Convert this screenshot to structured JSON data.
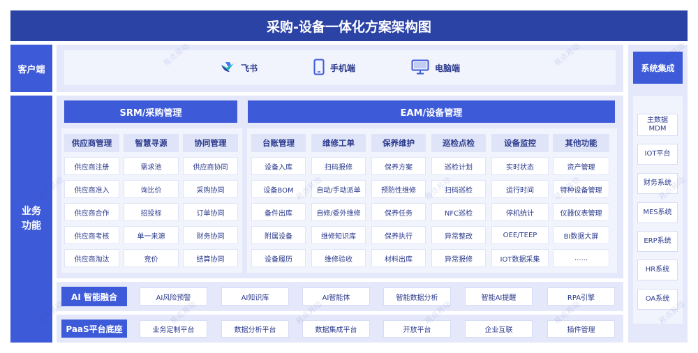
{
  "title": "采购-设备一体化方案架构图",
  "left_labels": {
    "client": "客户端",
    "business_line1": "业务",
    "business_line2": "功能"
  },
  "client_items": [
    {
      "icon": "feishu-icon",
      "label": "飞书"
    },
    {
      "icon": "mobile-phone-icon",
      "label": "手机端"
    },
    {
      "icon": "desktop-monitor-icon",
      "label": "电脑端"
    }
  ],
  "srm": {
    "title": "SRM/采购管理",
    "columns": [
      {
        "head": "供应商管理",
        "items": [
          "供应商注册",
          "供应商准入",
          "供应商合作",
          "供应商考核",
          "供应商淘汰"
        ]
      },
      {
        "head": "智慧寻源",
        "items": [
          "需求池",
          "询比价",
          "招投标",
          "单一来源",
          "竞价"
        ]
      },
      {
        "head": "协同管理",
        "items": [
          "供应商协同",
          "采购协同",
          "订单协同",
          "财务协同",
          "结算协同"
        ]
      }
    ]
  },
  "eam": {
    "title": "EAM/设备管理",
    "columns": [
      {
        "head": "台账管理",
        "items": [
          "设备入库",
          "设备BOM",
          "备件出库",
          "附属设备",
          "设备履历"
        ]
      },
      {
        "head": "维修工单",
        "items": [
          "扫码报修",
          "自动/手动派单",
          "自修/委外维修",
          "维修知识库",
          "维修验收"
        ]
      },
      {
        "head": "保养维护",
        "items": [
          "保养方案",
          "预防性维修",
          "保养任务",
          "保养执行",
          "材料出库"
        ]
      },
      {
        "head": "巡检点检",
        "items": [
          "巡检计划",
          "扫码巡检",
          "NFC巡检",
          "异常整改",
          "异常报修"
        ]
      },
      {
        "head": "设备监控",
        "items": [
          "实时状态",
          "运行时间",
          "停机统计",
          "OEE/TEEP",
          "IOT数据采集"
        ]
      },
      {
        "head": "其他功能",
        "items": [
          "资产管理",
          "特种设备管理",
          "仪器仪表管理",
          "BI数据大屏",
          "......"
        ]
      }
    ]
  },
  "ai_row": {
    "label": "AI 智能融合",
    "items": [
      "AI风险预警",
      "AI知识库",
      "AI智能体",
      "智能数据分析",
      "智能AI提醒",
      "RPA引擎"
    ]
  },
  "paas_row": {
    "label": "PaaS平台底座",
    "items": [
      "业务定制平台",
      "数据分析平台",
      "数据集成平台",
      "开放平台",
      "企业互联",
      "插件管理"
    ]
  },
  "system_integration": {
    "title": "系统集成",
    "items": [
      "主数据\nMDM",
      "IOT平台",
      "财务系统",
      "MES系统",
      "ERP系统",
      "HR系统",
      "OA系统"
    ]
  },
  "watermark": "易点易动",
  "colors": {
    "title_bg": "#2c43a6",
    "accent": "#3d5ad8",
    "panel": "#e4e8fa",
    "text": "#2b3a8c"
  }
}
